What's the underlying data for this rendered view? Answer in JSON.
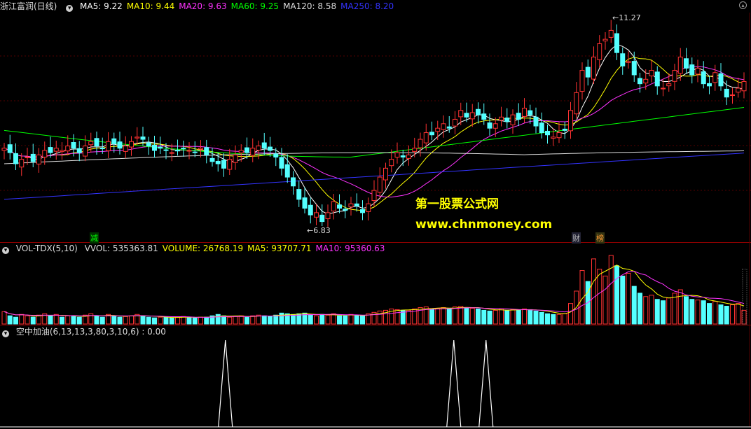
{
  "header": {
    "stock": "浙江富润(日线)",
    "ma": [
      {
        "label": "MA5: 9.22",
        "color": "#ffffff"
      },
      {
        "label": "MA10: 9.44",
        "color": "#ffff00"
      },
      {
        "label": "MA20: 9.63",
        "color": "#ff33ff"
      },
      {
        "label": "MA60: 9.25",
        "color": "#00ff00"
      },
      {
        "label": "MA120: 8.58",
        "color": "#dddddd"
      },
      {
        "label": "MA250: 8.20",
        "color": "#3333ff"
      }
    ]
  },
  "volume_header": {
    "name": "VOL-TDX(5,10)",
    "items": [
      {
        "label": "VVOL: 535363.81",
        "color": "#dddddd"
      },
      {
        "label": "VOLUME: 26768.19",
        "color": "#ffff00"
      },
      {
        "label": "MA5: 93707.71",
        "color": "#ffff00"
      },
      {
        "label": "MA10: 95360.63",
        "color": "#ff33ff"
      }
    ]
  },
  "indicator_header": {
    "label": "空中加油(6,13,13,3,80,3,10,6) : 0.00"
  },
  "annotations": {
    "high": "11.27",
    "low": "6.83",
    "jian": "减",
    "cai": "财",
    "bang": "榜"
  },
  "watermark": {
    "line1": "第一股票公式网",
    "line2": "www.chnmoney.com"
  },
  "chart_data": {
    "type": "candlestick",
    "price_range": [
      6.5,
      11.6
    ],
    "max_label": 11.27,
    "min_label": 6.83,
    "closes": [
      8.55,
      8.45,
      8.2,
      8.3,
      8.35,
      8.25,
      8.4,
      8.5,
      8.45,
      8.55,
      8.5,
      8.6,
      8.55,
      8.45,
      8.6,
      8.7,
      8.6,
      8.55,
      8.7,
      8.65,
      8.55,
      8.6,
      8.7,
      8.8,
      8.75,
      8.6,
      8.5,
      8.55,
      8.5,
      8.45,
      8.5,
      8.55,
      8.5,
      8.45,
      8.55,
      8.4,
      8.25,
      8.2,
      8.1,
      8.3,
      8.4,
      8.5,
      8.45,
      8.55,
      8.6,
      8.55,
      8.5,
      8.35,
      8.1,
      7.9,
      7.7,
      7.4,
      7.2,
      7.05,
      7.1,
      6.9,
      7.1,
      7.35,
      7.2,
      7.15,
      7.3,
      7.25,
      7.1,
      7.3,
      7.6,
      7.9,
      8.1,
      8.3,
      8.45,
      8.35,
      8.4,
      8.55,
      8.75,
      8.9,
      8.85,
      9.0,
      9.1,
      9.0,
      9.2,
      9.4,
      9.25,
      9.35,
      9.3,
      9.2,
      9.0,
      9.1,
      9.25,
      9.15,
      9.3,
      9.2,
      9.45,
      9.3,
      9.05,
      8.9,
      8.85,
      8.8,
      8.9,
      8.95,
      9.4,
      9.8,
      10.3,
      10.15,
      10.6,
      10.9,
      11.0,
      11.2,
      10.7,
      10.4,
      10.5,
      10.2,
      10.0,
      10.1,
      10.3,
      9.95,
      9.9,
      10.0,
      10.3,
      10.6,
      10.35,
      10.2,
      10.35,
      10.0,
      9.95,
      10.25,
      9.95,
      9.7,
      9.75,
      9.9,
      10.05
    ],
    "volume": [
      0.18,
      0.12,
      0.1,
      0.14,
      0.12,
      0.1,
      0.13,
      0.15,
      0.12,
      0.14,
      0.1,
      0.12,
      0.11,
      0.1,
      0.13,
      0.15,
      0.12,
      0.1,
      0.14,
      0.12,
      0.1,
      0.11,
      0.12,
      0.14,
      0.12,
      0.1,
      0.09,
      0.1,
      0.1,
      0.09,
      0.1,
      0.11,
      0.1,
      0.09,
      0.1,
      0.1,
      0.12,
      0.14,
      0.12,
      0.1,
      0.11,
      0.12,
      0.1,
      0.12,
      0.13,
      0.12,
      0.11,
      0.13,
      0.16,
      0.15,
      0.14,
      0.15,
      0.16,
      0.13,
      0.12,
      0.14,
      0.13,
      0.15,
      0.12,
      0.12,
      0.14,
      0.13,
      0.12,
      0.15,
      0.17,
      0.19,
      0.2,
      0.22,
      0.21,
      0.2,
      0.2,
      0.22,
      0.24,
      0.25,
      0.22,
      0.23,
      0.24,
      0.22,
      0.25,
      0.26,
      0.24,
      0.23,
      0.22,
      0.2,
      0.19,
      0.2,
      0.22,
      0.2,
      0.21,
      0.2,
      0.22,
      0.21,
      0.19,
      0.17,
      0.15,
      0.14,
      0.14,
      0.15,
      0.3,
      0.48,
      0.78,
      0.62,
      0.95,
      0.8,
      0.7,
      1.0,
      0.85,
      0.7,
      0.74,
      0.55,
      0.45,
      0.4,
      0.42,
      0.36,
      0.34,
      0.38,
      0.45,
      0.5,
      0.4,
      0.36,
      0.35,
      0.34,
      0.3,
      0.33,
      0.28,
      0.26,
      0.28,
      0.3,
      0.2
    ],
    "indicator_peaks": [
      {
        "index": 31,
        "value": 1
      },
      {
        "index": 79,
        "value": 1
      },
      {
        "index": 87,
        "value": 1
      }
    ]
  }
}
